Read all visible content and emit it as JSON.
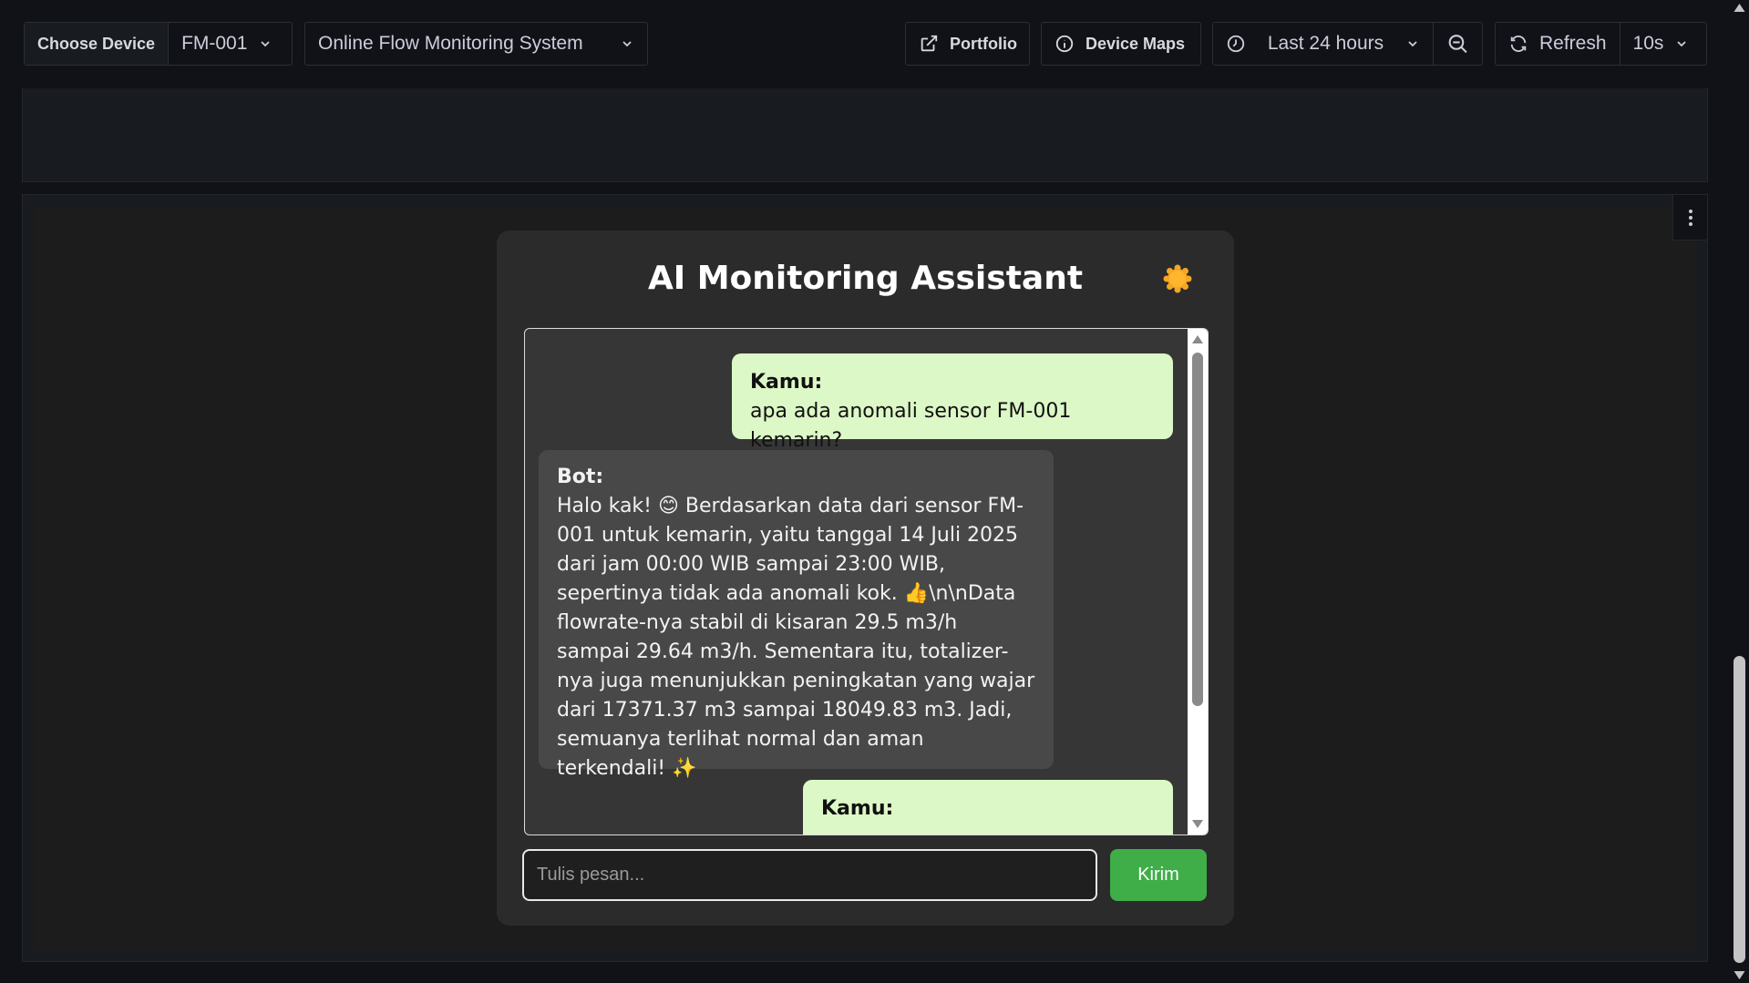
{
  "toolbar": {
    "device_label": "Choose Device",
    "device_value": "FM-001",
    "dashboard_value": "Online Flow Monitoring System",
    "portfolio_label": "Portfolio",
    "device_maps_label": "Device Maps",
    "time_range": "Last 24 hours",
    "refresh_label": "Refresh",
    "refresh_interval": "10s"
  },
  "chat": {
    "title": "AI Monitoring Assistant",
    "theme_icon": "sun-icon",
    "messages": [
      {
        "role": "user",
        "who": "Kamu:",
        "text": "apa ada anomali sensor FM-001 kemarin?"
      },
      {
        "role": "bot",
        "who": "Bot:",
        "text": "Halo kak! 😊 Berdasarkan data dari sensor FM-001 untuk kemarin, yaitu tanggal 14 Juli 2025 dari jam 00:00 WIB sampai 23:00 WIB, sepertinya tidak ada anomali kok. 👍\\n\\nData flowrate-nya stabil di kisaran 29.5 m3/h sampai 29.64 m3/h. Sementara itu, totalizer-nya juga menunjukkan peningkatan yang wajar dari 17371.37 m3 sampai 18049.83 m3. Jadi, semuanya terlihat normal dan aman terkendali! ✨"
      },
      {
        "role": "user",
        "who": "Kamu:",
        "text": ""
      }
    ],
    "input_placeholder": "Tulis pesan...",
    "send_label": "Kirim"
  },
  "colors": {
    "user_bubble": "#dcf8c6",
    "bot_bubble": "#484848",
    "send_button": "#3fae49",
    "sun": "#f5a623"
  }
}
